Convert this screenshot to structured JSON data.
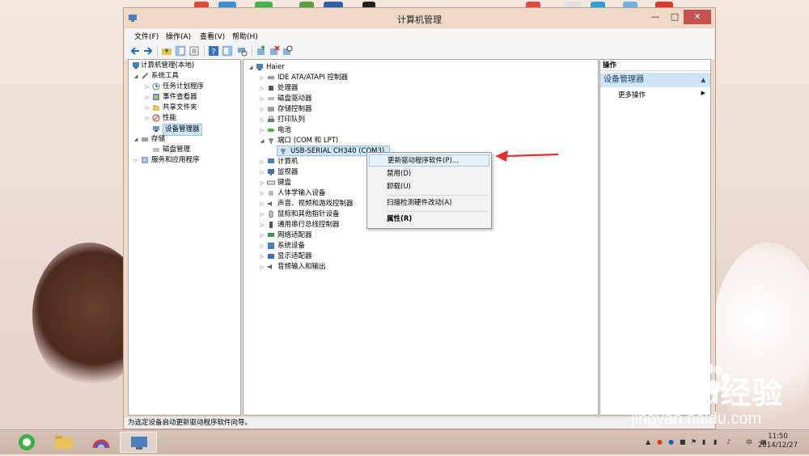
{
  "window": {
    "title": "计算机管理",
    "menus": [
      "文件(F)",
      "操作(A)",
      "查看(V)",
      "帮助(H)"
    ],
    "status": "为选定设备启动更新驱动程序软件向导。"
  },
  "left_tree": [
    {
      "label": "计算机管理(本地)",
      "icon": "computer-management-icon"
    },
    {
      "label": "系统工具",
      "icon": "tools-icon"
    },
    {
      "label": "任务计划程序",
      "icon": "clock-icon"
    },
    {
      "label": "事件查看器",
      "icon": "event-viewer-icon"
    },
    {
      "label": "共享文件夹",
      "icon": "shared-folder-icon"
    },
    {
      "label": "性能",
      "icon": "performance-icon"
    },
    {
      "label": "设备管理器",
      "icon": "device-manager-icon"
    },
    {
      "label": "存储",
      "icon": "storage-icon"
    },
    {
      "label": "磁盘管理",
      "icon": "disk-icon"
    },
    {
      "label": "服务和应用程序",
      "icon": "services-icon"
    }
  ],
  "device_tree": {
    "root": "Haier",
    "items": [
      "IDE ATA/ATAPI 控制器",
      "处理器",
      "磁盘驱动器",
      "存储控制器",
      "打印队列",
      "电池",
      "端口 (COM 和 LPT)",
      "USB-SERIAL CH340 (COM3)",
      "计算机",
      "监视器",
      "键盘",
      "人体学输入设备",
      "声音、视频和游戏控制器",
      "鼠标和其他指针设备",
      "通用串行总线控制器",
      "网络适配器",
      "系统设备",
      "显示适配器",
      "音频输入和输出"
    ]
  },
  "context_menu": {
    "update": "更新驱动程序软件(P)...",
    "disable": "禁用(D)",
    "uninstall": "卸载(U)",
    "scan": "扫描检测硬件改动(A)",
    "properties": "属性(R)"
  },
  "actions": {
    "header": "操作",
    "section": "设备管理器",
    "more": "更多操作"
  },
  "watermark": {
    "logo": "Baidu经验",
    "url": "jingyan.baidu.com"
  },
  "taskbar": {
    "time": "11:50",
    "date": "2014/12/27",
    "ime": "中"
  },
  "colors": {
    "selection": "#cce8ff",
    "close_button": "#c75050",
    "arrow": "#e03030",
    "action_section": "#cfe4f7"
  }
}
